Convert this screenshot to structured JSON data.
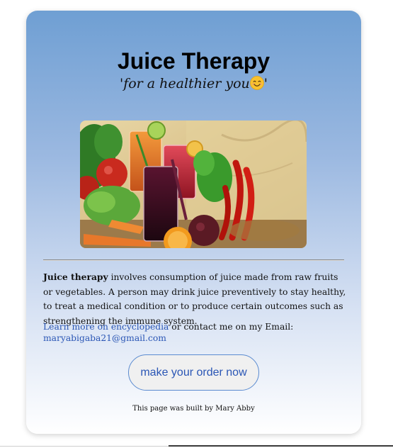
{
  "page": {
    "title": "Juice Therapy",
    "tagline_before": "'for a healthier you",
    "tagline_after": "'"
  },
  "hero_image": {
    "icon": "juice-vegetables-photo"
  },
  "description": {
    "bold_term": "Juice therapy",
    "text": " involves consumption of juice made from raw fruits or vegetables. A person may drink juice preventively to stay healthy, to treat a medical condition or to produce certain outcomes such as strengthening the immune system."
  },
  "contact": {
    "link_label": "Learn more on encyclopedia",
    "middle_text": " or contact me on my Email:",
    "email": "maryabigaba21@gmail.com"
  },
  "order_button": {
    "label": "make your order now"
  },
  "footer": {
    "text": "This page was built by Mary Abby"
  },
  "colors": {
    "gradient_top": "#6f9fd3",
    "gradient_bottom": "#ffffff",
    "link": "#2a56b5",
    "button_border": "#5b8bd0"
  }
}
